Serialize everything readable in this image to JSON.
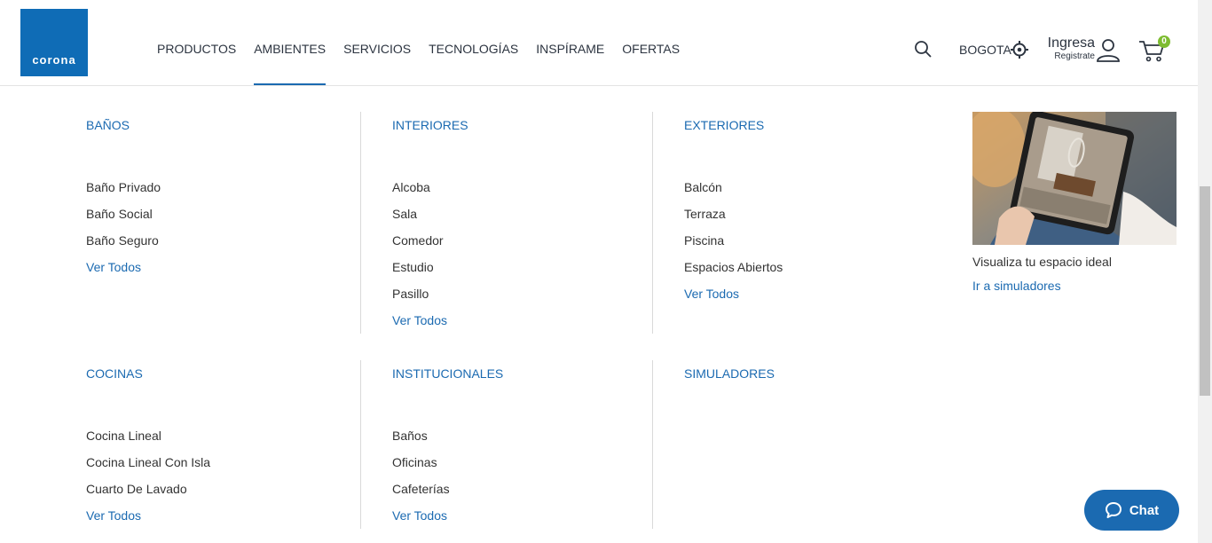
{
  "brand": {
    "logo_text": "corona"
  },
  "nav": [
    {
      "label": "PRODUCTOS",
      "active": false
    },
    {
      "label": "AMBIENTES",
      "active": true
    },
    {
      "label": "SERVICIOS",
      "active": false
    },
    {
      "label": "TECNOLOGÍAS",
      "active": false
    },
    {
      "label": "INSPÍRAME",
      "active": false
    },
    {
      "label": "OFERTAS",
      "active": false
    }
  ],
  "header": {
    "city": "BOGOTA",
    "login": "Ingresa",
    "register": "Registrate",
    "cart_count": "0",
    "icons": [
      "search-icon",
      "location-icon",
      "user-icon",
      "cart-icon"
    ]
  },
  "menu": {
    "banos": {
      "title": "BAÑOS",
      "items": [
        "Baño Privado",
        "Baño Social",
        "Baño Seguro"
      ],
      "more": "Ver Todos"
    },
    "interiores": {
      "title": "INTERIORES",
      "items": [
        "Alcoba",
        "Sala",
        "Comedor",
        "Estudio",
        "Pasillo"
      ],
      "more": "Ver Todos"
    },
    "exteriores": {
      "title": "EXTERIORES",
      "items": [
        "Balcón",
        "Terraza",
        "Piscina",
        "Espacios Abiertos"
      ],
      "more": "Ver Todos"
    },
    "cocinas": {
      "title": "COCINAS",
      "items": [
        "Cocina Lineal",
        "Cocina Lineal Con Isla",
        "Cuarto De Lavado"
      ],
      "more": "Ver Todos"
    },
    "institucionales": {
      "title": "INSTITUCIONALES",
      "items": [
        "Baños",
        "Oficinas",
        "Cafeterías"
      ],
      "more": "Ver Todos"
    },
    "simuladores": {
      "title": "SIMULADORES"
    }
  },
  "promo": {
    "caption": "Visualiza tu espacio ideal",
    "link": "Ir a simuladores"
  },
  "chat": {
    "label": "Chat"
  },
  "colors": {
    "brand_blue": "#0f6cb6",
    "link_blue": "#1b6ab1",
    "badge_green": "#7dbc30"
  }
}
